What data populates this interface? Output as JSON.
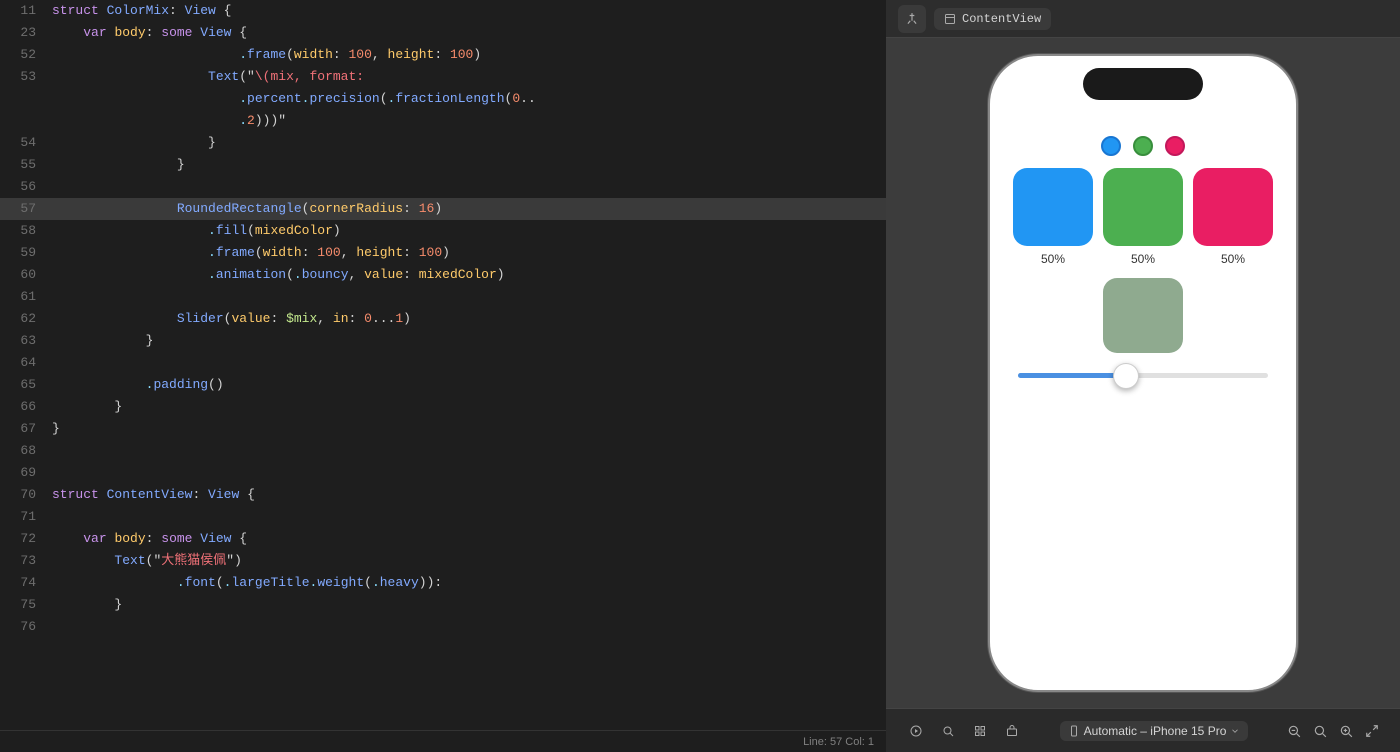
{
  "editor": {
    "lines": [
      {
        "num": "11",
        "tokens": [
          {
            "t": "kw-struct",
            "v": "struct "
          },
          {
            "t": "kw-type",
            "v": "ColorMix"
          },
          {
            "t": "kw-plain",
            "v": ": "
          },
          {
            "t": "kw-type",
            "v": "View"
          },
          {
            "t": "kw-plain",
            "v": " {"
          }
        ]
      },
      {
        "num": "23",
        "tokens": [
          {
            "t": "kw-plain",
            "v": "    "
          },
          {
            "t": "kw-var",
            "v": "var "
          },
          {
            "t": "kw-yellow",
            "v": "body"
          },
          {
            "t": "kw-plain",
            "v": ": "
          },
          {
            "t": "kw-some",
            "v": "some "
          },
          {
            "t": "kw-type",
            "v": "View"
          },
          {
            "t": "kw-plain",
            "v": " {"
          }
        ]
      },
      {
        "num": "52",
        "tokens": [
          {
            "t": "kw-plain",
            "v": "                        "
          },
          {
            "t": "kw-dot",
            "v": "."
          },
          {
            "t": "kw-func",
            "v": "frame"
          },
          {
            "t": "kw-plain",
            "v": "("
          },
          {
            "t": "kw-param",
            "v": "width"
          },
          {
            "t": "kw-plain",
            "v": ": "
          },
          {
            "t": "kw-number",
            "v": "100"
          },
          {
            "t": "kw-plain",
            "v": ", "
          },
          {
            "t": "kw-param",
            "v": "height"
          },
          {
            "t": "kw-plain",
            "v": ": "
          },
          {
            "t": "kw-number",
            "v": "100"
          },
          {
            "t": "kw-plain",
            "v": ")"
          }
        ]
      },
      {
        "num": "53",
        "tokens": [
          {
            "t": "kw-plain",
            "v": "                    "
          },
          {
            "t": "kw-type",
            "v": "Text"
          },
          {
            "t": "kw-plain",
            "v": "(\""
          },
          {
            "t": "kw-string",
            "v": "\\(mix, format:"
          },
          {
            "t": "kw-plain",
            "v": ""
          }
        ]
      },
      {
        "num": "",
        "tokens": [
          {
            "t": "kw-plain",
            "v": "                        "
          },
          {
            "t": "kw-dot",
            "v": "."
          },
          {
            "t": "kw-func",
            "v": "percent"
          },
          {
            "t": "kw-dot",
            "v": "."
          },
          {
            "t": "kw-func",
            "v": "precision"
          },
          {
            "t": "kw-plain",
            "v": "("
          },
          {
            "t": "kw-dot",
            "v": "."
          },
          {
            "t": "kw-func",
            "v": "fractionLength"
          },
          {
            "t": "kw-plain",
            "v": "("
          },
          {
            "t": "kw-number",
            "v": "0"
          },
          {
            "t": "kw-plain",
            "v": ".."
          }
        ]
      },
      {
        "num": "",
        "tokens": [
          {
            "t": "kw-plain",
            "v": "                        "
          },
          {
            "t": "kw-dot",
            "v": "."
          },
          {
            "t": "kw-number",
            "v": "2"
          },
          {
            "t": "kw-plain",
            "v": ")))\""
          }
        ]
      },
      {
        "num": "54",
        "tokens": [
          {
            "t": "kw-plain",
            "v": "                    }"
          }
        ]
      },
      {
        "num": "55",
        "tokens": [
          {
            "t": "kw-plain",
            "v": "                }"
          }
        ]
      },
      {
        "num": "56",
        "tokens": []
      },
      {
        "num": "57",
        "tokens": [
          {
            "t": "kw-plain",
            "v": "                "
          },
          {
            "t": "kw-type",
            "v": "RoundedRectangle"
          },
          {
            "t": "kw-plain",
            "v": "("
          },
          {
            "t": "kw-param",
            "v": "cornerRadius"
          },
          {
            "t": "kw-plain",
            "v": ": "
          },
          {
            "t": "kw-number",
            "v": "16"
          },
          {
            "t": "kw-plain",
            "v": ")"
          }
        ],
        "highlighted": true
      },
      {
        "num": "58",
        "tokens": [
          {
            "t": "kw-plain",
            "v": "                    "
          },
          {
            "t": "kw-dot",
            "v": "."
          },
          {
            "t": "kw-func",
            "v": "fill"
          },
          {
            "t": "kw-plain",
            "v": "("
          },
          {
            "t": "kw-yellow",
            "v": "mixedColor"
          },
          {
            "t": "kw-plain",
            "v": ")"
          }
        ]
      },
      {
        "num": "59",
        "tokens": [
          {
            "t": "kw-plain",
            "v": "                    "
          },
          {
            "t": "kw-dot",
            "v": "."
          },
          {
            "t": "kw-func",
            "v": "frame"
          },
          {
            "t": "kw-plain",
            "v": "("
          },
          {
            "t": "kw-param",
            "v": "width"
          },
          {
            "t": "kw-plain",
            "v": ": "
          },
          {
            "t": "kw-number",
            "v": "100"
          },
          {
            "t": "kw-plain",
            "v": ", "
          },
          {
            "t": "kw-param",
            "v": "height"
          },
          {
            "t": "kw-plain",
            "v": ": "
          },
          {
            "t": "kw-number",
            "v": "100"
          },
          {
            "t": "kw-plain",
            "v": ")"
          }
        ]
      },
      {
        "num": "60",
        "tokens": [
          {
            "t": "kw-plain",
            "v": "                    "
          },
          {
            "t": "kw-dot",
            "v": "."
          },
          {
            "t": "kw-func",
            "v": "animation"
          },
          {
            "t": "kw-plain",
            "v": "("
          },
          {
            "t": "kw-dot",
            "v": "."
          },
          {
            "t": "kw-func",
            "v": "bouncy"
          },
          {
            "t": "kw-plain",
            "v": ", "
          },
          {
            "t": "kw-param",
            "v": "value"
          },
          {
            "t": "kw-plain",
            "v": ": "
          },
          {
            "t": "kw-yellow",
            "v": "mixedColor"
          },
          {
            "t": "kw-plain",
            "v": ")"
          }
        ]
      },
      {
        "num": "61",
        "tokens": []
      },
      {
        "num": "62",
        "tokens": [
          {
            "t": "kw-plain",
            "v": "                "
          },
          {
            "t": "kw-type",
            "v": "Slider"
          },
          {
            "t": "kw-plain",
            "v": "("
          },
          {
            "t": "kw-param",
            "v": "value"
          },
          {
            "t": "kw-plain",
            "v": ": "
          },
          {
            "t": "kw-green",
            "v": "$mix"
          },
          {
            "t": "kw-plain",
            "v": ", "
          },
          {
            "t": "kw-param",
            "v": "in"
          },
          {
            "t": "kw-plain",
            "v": ": "
          },
          {
            "t": "kw-number",
            "v": "0"
          },
          {
            "t": "kw-plain",
            "v": "..."
          },
          {
            "t": "kw-number",
            "v": "1"
          },
          {
            "t": "kw-plain",
            "v": ")"
          }
        ]
      },
      {
        "num": "63",
        "tokens": [
          {
            "t": "kw-plain",
            "v": "            }"
          }
        ]
      },
      {
        "num": "64",
        "tokens": []
      },
      {
        "num": "65",
        "tokens": [
          {
            "t": "kw-plain",
            "v": "            "
          },
          {
            "t": "kw-dot",
            "v": "."
          },
          {
            "t": "kw-func",
            "v": "padding"
          },
          {
            "t": "kw-plain",
            "v": "()"
          }
        ]
      },
      {
        "num": "66",
        "tokens": [
          {
            "t": "kw-plain",
            "v": "        }"
          }
        ]
      },
      {
        "num": "67",
        "tokens": [
          {
            "t": "kw-plain",
            "v": "}"
          }
        ]
      },
      {
        "num": "68",
        "tokens": []
      },
      {
        "num": "69",
        "tokens": []
      },
      {
        "num": "70",
        "tokens": [
          {
            "t": "kw-struct",
            "v": "struct "
          },
          {
            "t": "kw-type",
            "v": "ContentView"
          },
          {
            "t": "kw-plain",
            "v": ": "
          },
          {
            "t": "kw-type",
            "v": "View"
          },
          {
            "t": "kw-plain",
            "v": " {"
          }
        ]
      },
      {
        "num": "71",
        "tokens": []
      },
      {
        "num": "72",
        "tokens": [
          {
            "t": "kw-plain",
            "v": "    "
          },
          {
            "t": "kw-var",
            "v": "var "
          },
          {
            "t": "kw-yellow",
            "v": "body"
          },
          {
            "t": "kw-plain",
            "v": ": "
          },
          {
            "t": "kw-some",
            "v": "some "
          },
          {
            "t": "kw-type",
            "v": "View"
          },
          {
            "t": "kw-plain",
            "v": " {"
          }
        ]
      },
      {
        "num": "73",
        "tokens": [
          {
            "t": "kw-plain",
            "v": "        "
          },
          {
            "t": "kw-type",
            "v": "Text"
          },
          {
            "t": "kw-plain",
            "v": "(\""
          },
          {
            "t": "kw-string",
            "v": "大熊猫侯佩"
          },
          {
            "t": "kw-plain",
            "v": "\")"
          }
        ]
      },
      {
        "num": "74",
        "tokens": [
          {
            "t": "kw-plain",
            "v": "                "
          },
          {
            "t": "kw-dot",
            "v": "."
          },
          {
            "t": "kw-func",
            "v": "font"
          },
          {
            "t": "kw-plain",
            "v": "("
          },
          {
            "t": "kw-dot",
            "v": "."
          },
          {
            "t": "kw-func",
            "v": "largeTitle"
          },
          {
            "t": "kw-dot",
            "v": "."
          },
          {
            "t": "kw-func",
            "v": "weight"
          },
          {
            "t": "kw-plain",
            "v": "("
          },
          {
            "t": "kw-dot",
            "v": "."
          },
          {
            "t": "kw-func",
            "v": "heavy"
          },
          {
            "t": "kw-plain",
            "v": ")):"
          }
        ]
      },
      {
        "num": "75",
        "tokens": [
          {
            "t": "kw-plain",
            "v": "        }"
          }
        ]
      },
      {
        "num": "76",
        "tokens": []
      }
    ],
    "status_bar": "Line: 57  Col: 1"
  },
  "preview": {
    "pin_icon": "📌",
    "content_view_label": "ContentView",
    "iphone": {
      "color_circles": [
        {
          "color": "#2196F3",
          "border": "#1976D2"
        },
        {
          "color": "#4CAF50",
          "border": "#388E3C"
        },
        {
          "color": "#E91E63",
          "border": "#C2185B"
        }
      ],
      "swatches": [
        {
          "color": "#2196F3",
          "label": "50%"
        },
        {
          "color": "#4CAF50",
          "label": "50%"
        },
        {
          "color": "#E91E63",
          "label": "50%"
        }
      ],
      "mixed_color": "#8faa8f",
      "slider_value": 45
    },
    "bottom_bar": {
      "device_label": "Automatic – iPhone 15 Pro",
      "zoom_minus": "−",
      "zoom_fit": "⊡",
      "zoom_plus": "+",
      "zoom_full": "⛶"
    }
  }
}
